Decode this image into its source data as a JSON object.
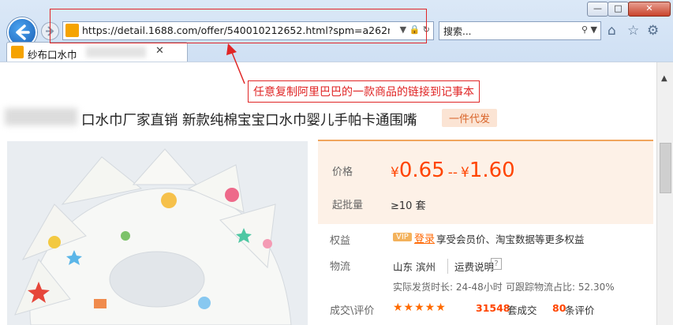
{
  "browser": {
    "url": "https://detail.1688.com/offer/540010212652.html?spm=a262n.8097",
    "search_placeholder": "搜索...",
    "tab_title": "纱布口水巾",
    "window_buttons": {
      "minimize": "—",
      "maximize": "□",
      "close": "✕"
    },
    "toolbar_icons": [
      "home-icon",
      "favorites-star-icon",
      "settings-gear-icon"
    ]
  },
  "annotation": {
    "label": "任意复制阿里巴巴的一款商品的链接到记事本",
    "color": "#e02626"
  },
  "product": {
    "title": "口水巾厂家直销 新款纯棉宝宝口水巾婴儿手帕卡通围嘴",
    "badge": "一件代发",
    "price_label": "价格",
    "price_low": "0.65",
    "price_high": "1.60",
    "currency": "¥",
    "price_separator": "--",
    "moq_label": "起批量",
    "moq_value": "≥10 套",
    "rights_label": "权益",
    "vip": "VIP",
    "login_link": "登录",
    "rights_text": "享受会员价、淘宝数据等更多权益",
    "logistics_label": "物流",
    "location": "山东 滨州",
    "fee_link": "运费说明",
    "fee_help": "?",
    "ship_time": "实际发货时长: 24-48小时",
    "track_rate": "可跟踪物流占比: 52.30%",
    "deal_label": "成交\\评价",
    "stars": "★★★★★",
    "rating": 4.5,
    "deals_count": "31548",
    "deals_unit": "套成交",
    "review_count": "80",
    "review_unit": "条评价",
    "accent_color": "#ff4400"
  }
}
